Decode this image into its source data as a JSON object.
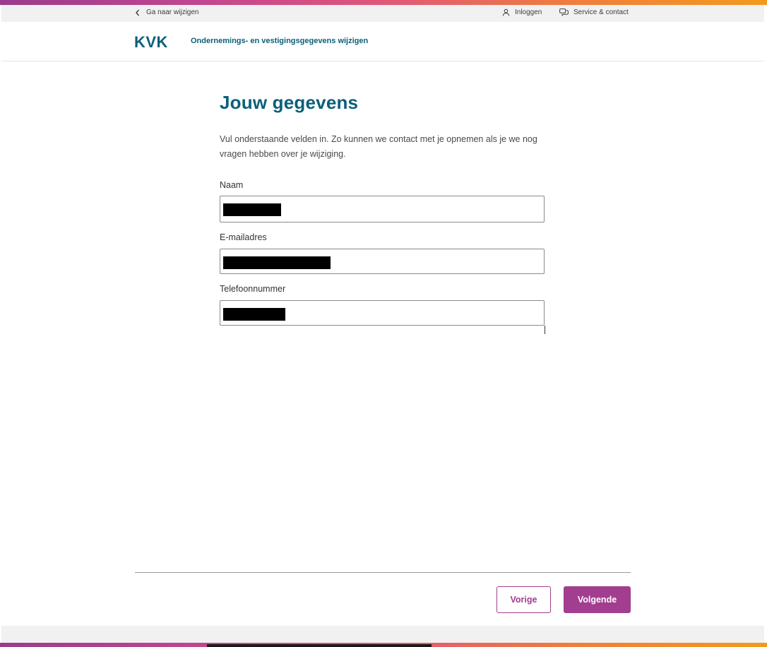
{
  "topbar": {
    "back_label": "Ga naar wijzigen",
    "login_label": "Inloggen",
    "service_label": "Service & contact"
  },
  "header": {
    "logo_text": "KVK",
    "title": "Ondernemings- en vestigingsgegevens wijzigen"
  },
  "main": {
    "title": "Jouw gegevens",
    "intro": "Vul onderstaande velden in. Zo kunnen we contact met je opnemen als je we nog vragen hebben over je wijziging.",
    "fields": [
      {
        "label": "Naam",
        "value": ""
      },
      {
        "label": "E-mailadres",
        "value": ""
      },
      {
        "label": "Telefoonnummer",
        "value": ""
      }
    ]
  },
  "footer": {
    "prev_label": "Vorige",
    "next_label": "Volgende"
  },
  "colors": {
    "brand_teal": "#0a5f7a",
    "accent_purple": "#a23d8f"
  }
}
